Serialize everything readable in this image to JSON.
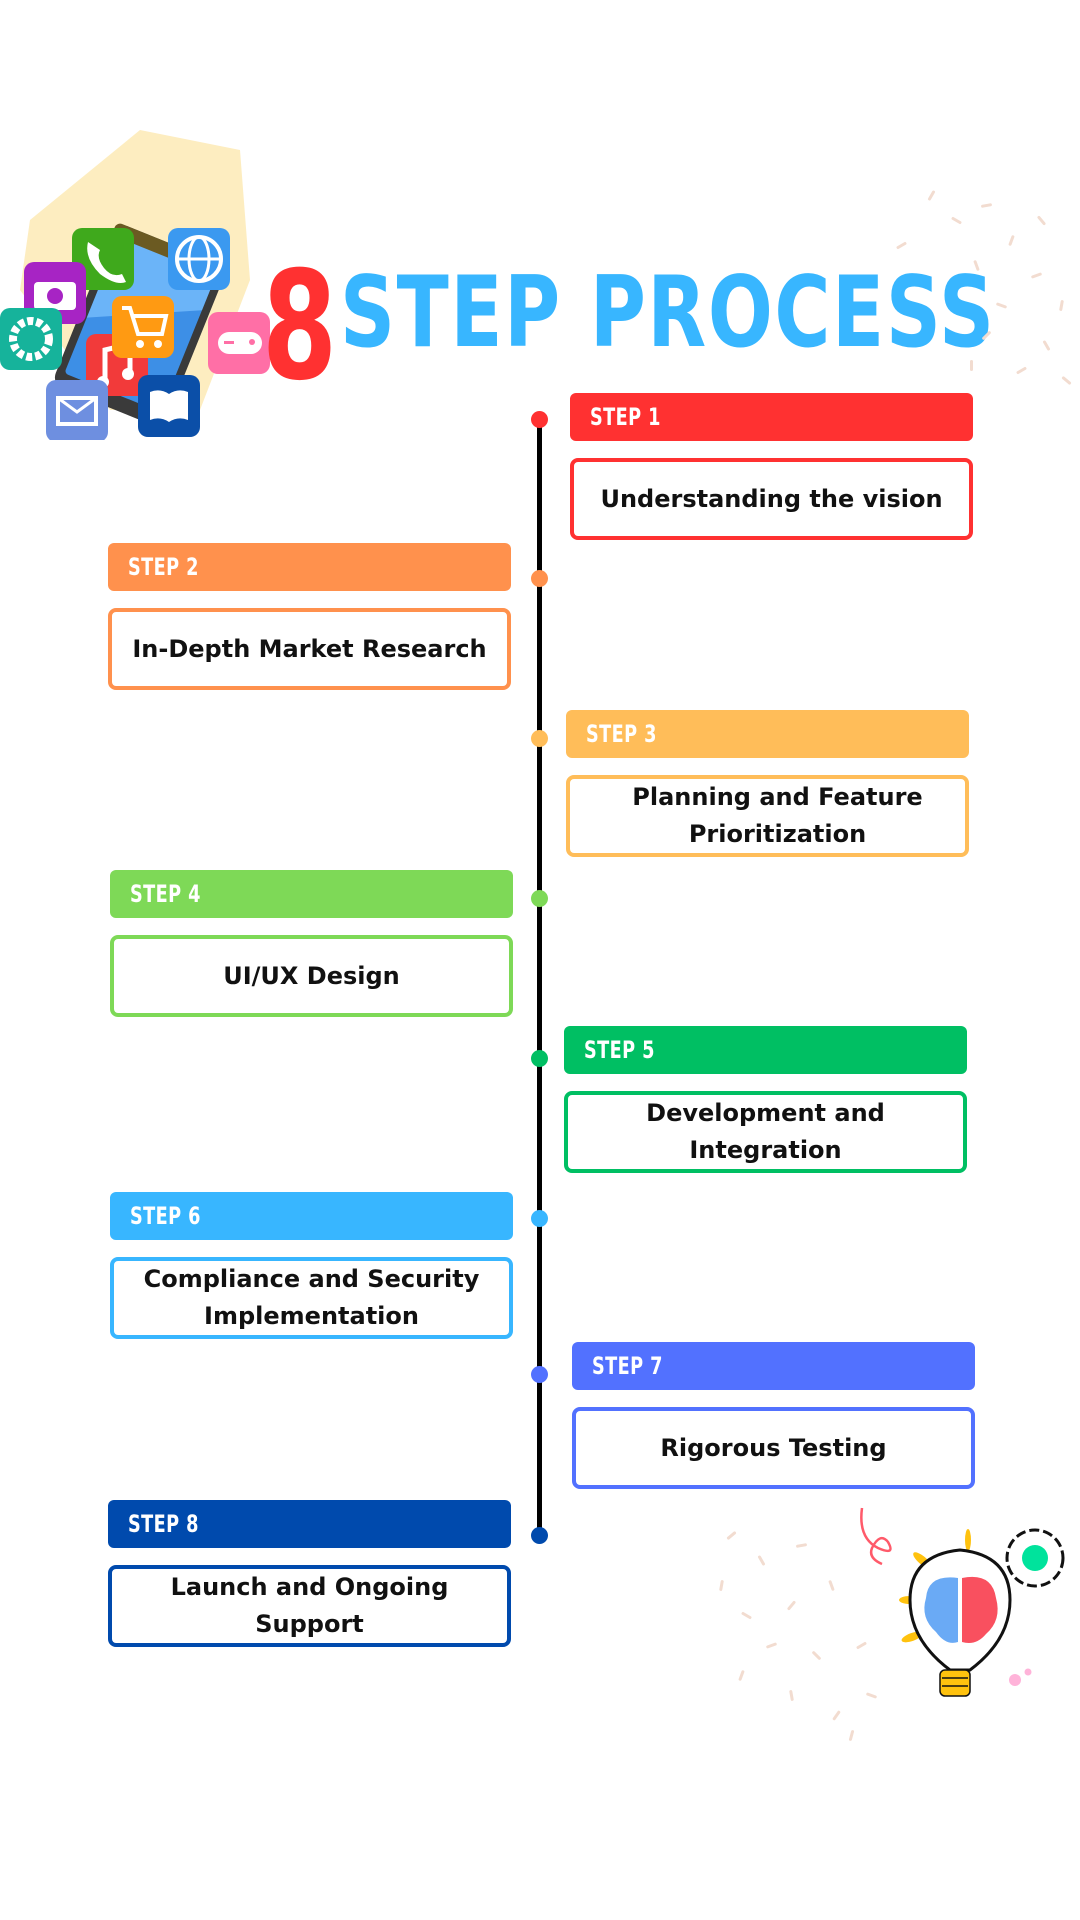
{
  "title": {
    "number": "8",
    "text": "STEP PROCESS"
  },
  "colors": {
    "title_number": "#ff3131",
    "title_text": "#38b6ff",
    "timeline": "#000000"
  },
  "steps": [
    {
      "label": "STEP 1",
      "text": "Understanding the vision",
      "color": "#ff3131",
      "side": "right"
    },
    {
      "label": "STEP 2",
      "text": "In-Depth Market Research",
      "color": "#ff914d",
      "side": "left"
    },
    {
      "label": "STEP 3",
      "text": "Planning and Feature Prioritization",
      "color": "#ffbd59",
      "side": "right"
    },
    {
      "label": "STEP 4",
      "text": "UI/UX Design",
      "color": "#7ed957",
      "side": "left"
    },
    {
      "label": "STEP 5",
      "text": "Development and Integration",
      "color": "#00bf63",
      "side": "right"
    },
    {
      "label": "STEP 6",
      "text": "Compliance and Security Implementation",
      "color": "#38b6ff",
      "side": "left"
    },
    {
      "label": "STEP 7",
      "text": "Rigorous Testing",
      "color": "#5271ff",
      "side": "right"
    },
    {
      "label": "STEP 8",
      "text": "Launch and Ongoing Support",
      "color": "#004aad",
      "side": "left"
    }
  ],
  "illustrations": {
    "top_left": "smartphone-with-app-icons",
    "bottom_right": "lightbulb-brain-gear"
  }
}
